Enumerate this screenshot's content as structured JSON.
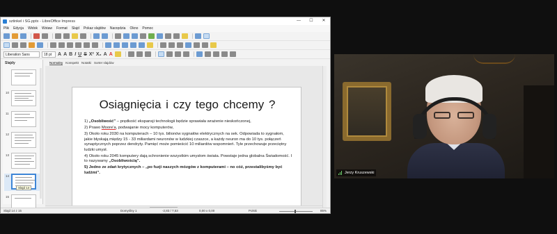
{
  "window": {
    "title": "sztinkel i SG.pptx - LibreOffice Impress",
    "controls": [
      "—",
      "☐",
      "✕"
    ]
  },
  "menu": [
    "Plik",
    "Edycja",
    "Widok",
    "Wstaw",
    "Format",
    "Slajd",
    "Pokaz slajdów",
    "Narzędzia",
    "Okno",
    "Pomoc"
  ],
  "font": {
    "name": "Liberation Sans",
    "size": "18 pt"
  },
  "format_chars": [
    "A",
    "A",
    "B",
    "I",
    "U",
    "S",
    "X²",
    "X₂",
    "A",
    "A"
  ],
  "slides_pane": {
    "title": "Slajdy",
    "numbers": [
      "",
      "10",
      "11",
      "12",
      "13",
      "14",
      "15"
    ],
    "tooltip": "Slajd 14"
  },
  "view_tabs": [
    "Normalny",
    "Konspekt",
    "Notatki",
    "Sorter slajdów"
  ],
  "slide": {
    "title": "Osiągnięcia   i czy  tego  chcemy ?",
    "items": [
      {
        "num": "1)",
        "bold": "„Osobliwość”",
        "text": " – prędkość ekspansji technologii będzie sprawiała wrażenie nieskończonej,"
      },
      {
        "num": "2)",
        "pre": "Prawo ",
        "underlined": "Moore'a",
        "text": ", podwajanie mocy komputerów,"
      },
      {
        "num": "3)",
        "text": "Około roku 2030 na komputerach – 10 tys. bilionów sygnałów elektrycznych na sek. Odpowiada to sygnałom, jakie błyskają między 15 - 33 miliardami neuronów w ludzkiej czaszce, a każdy neuron ma do 10 tys. połączeń synaptycznych poprzez dendryty. Pamięć może pomieścić 10 miliardów wspomnień. Tyle przechowuje przeciętny ludzki umysł."
      },
      {
        "num": "4)",
        "text": "Około roku 2045 komputery dają schronienie wszystkim umysłom świata. Powstaje jedna globalna Świadomość. I to nazywamy  ",
        "bold": "„Osobliwością”."
      },
      {
        "num": "5)",
        "bold": "Jedno ze zdań krytycznych – „po fuzji naszych mózgów z komputerami – no cóż, przestalibyśmy być ludźmi”."
      }
    ]
  },
  "status": {
    "slide": "Slajd 14 z 15",
    "layout": "Domyślny 1",
    "position": "-2,83 / 7,53",
    "size": "0,00 x 0,00",
    "language": "Polski",
    "zoom": "85%"
  },
  "video": {
    "participant_name": "Jerzy Kruszewski"
  }
}
